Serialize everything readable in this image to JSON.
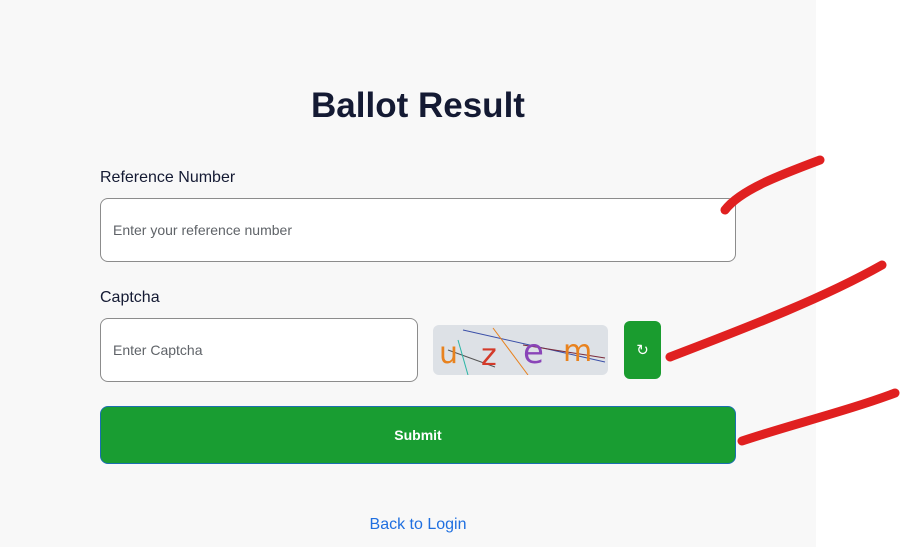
{
  "page": {
    "title": "Ballot Result",
    "back_link": "Back to Login"
  },
  "reference": {
    "label": "Reference Number",
    "placeholder": "Enter your reference number",
    "value": ""
  },
  "captcha": {
    "label": "Captcha",
    "placeholder": "Enter Captcha",
    "value": "",
    "image_text": "uzem",
    "refresh_icon": "refresh-icon",
    "refresh_glyph": "↻"
  },
  "actions": {
    "submit_label": "Submit"
  },
  "colors": {
    "primary_green": "#199d32",
    "link_blue": "#1f6fe0",
    "annotation_red": "#e02020",
    "title_text": "#141a33"
  }
}
